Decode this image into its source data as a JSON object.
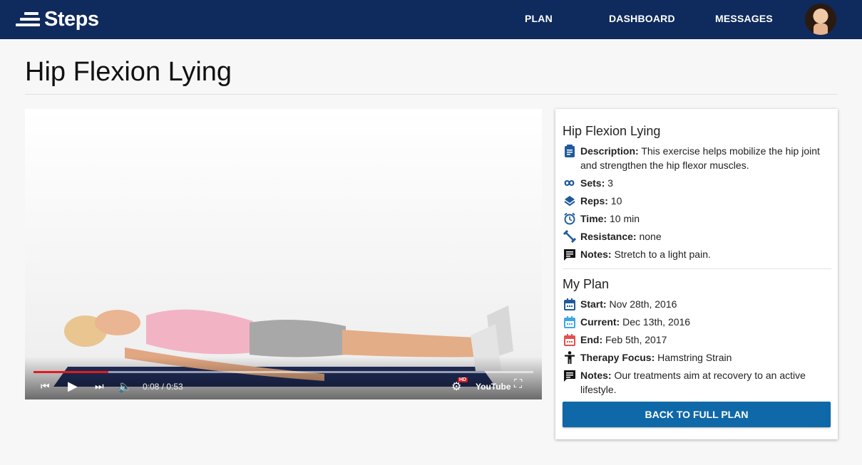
{
  "brand": {
    "name": "Steps"
  },
  "nav": {
    "plan": "PLAN",
    "dashboard": "DASHBOARD",
    "messages": "MESSAGES"
  },
  "page": {
    "title": "Hip Flexion Lying"
  },
  "video": {
    "time": "0:08 / 0:53",
    "progress": 0.15,
    "youtube": "YouTube",
    "hd": "HD"
  },
  "exercise": {
    "title": "Hip Flexion Lying",
    "description_label": "Description:",
    "description": "This exercise helps mobilize the hip joint and strengthen the hip flexor muscles.",
    "sets_label": "Sets:",
    "sets": "3",
    "reps_label": "Reps:",
    "reps": "10",
    "time_label": "Time:",
    "time": "10 min",
    "resistance_label": "Resistance:",
    "resistance": "none",
    "notes_label": "Notes:",
    "notes": "Stretch to a light pain."
  },
  "plan": {
    "title": "My Plan",
    "start_label": "Start:",
    "start": "Nov 28th, 2016",
    "current_label": "Current:",
    "current": "Dec 13th, 2016",
    "end_label": "End:",
    "end": "Feb 5th, 2017",
    "focus_label": "Therapy Focus:",
    "focus": "Hamstring Strain",
    "notes_label": "Notes:",
    "notes": "Our treatments aim at recovery to an active lifestyle."
  },
  "button": {
    "back": "BACK TO FULL PLAN"
  },
  "colors": {
    "navbar": "#0f2a5c",
    "accent": "#0f68a8",
    "progress": "#e21b1b",
    "calendar_current": "#3fa7e0",
    "calendar_end": "#e0524d"
  }
}
